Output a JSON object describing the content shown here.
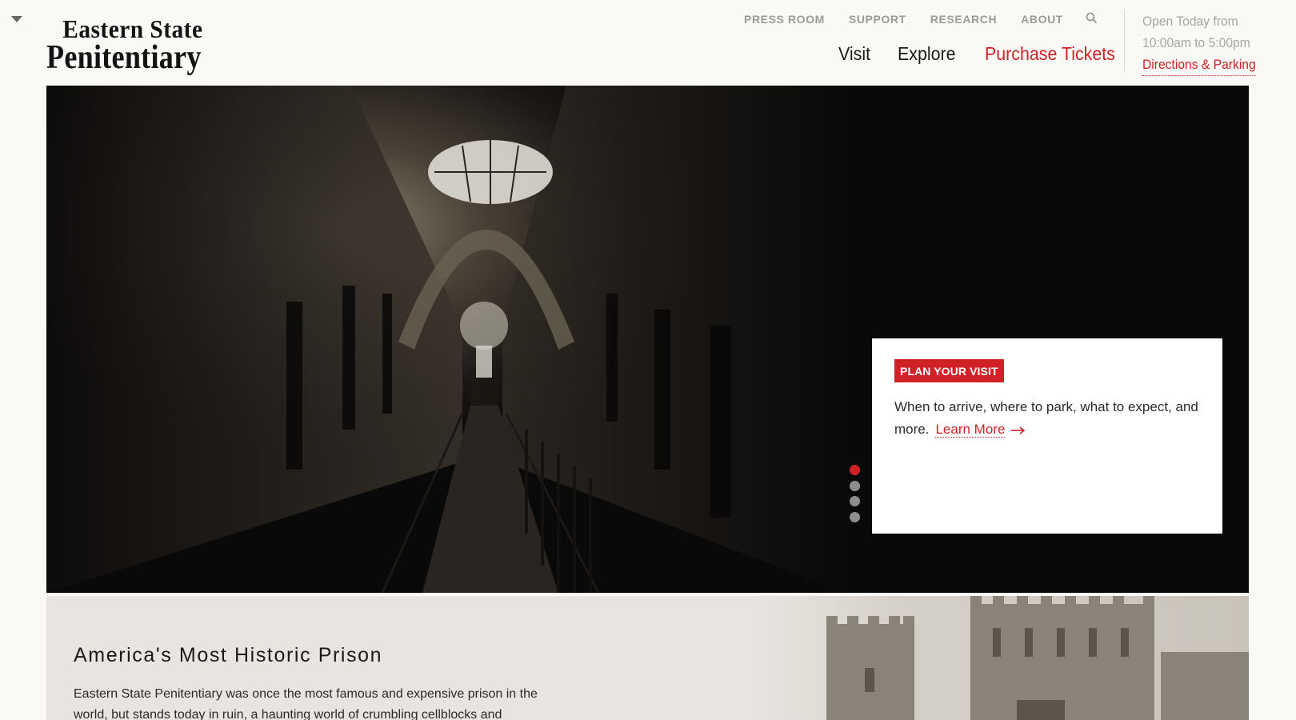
{
  "logo": {
    "line1": "Eastern State",
    "line2": "Penitentiary"
  },
  "utility_nav": [
    {
      "label": "PRESS ROOM"
    },
    {
      "label": "SUPPORT"
    },
    {
      "label": "RESEARCH"
    },
    {
      "label": "ABOUT"
    }
  ],
  "main_nav": {
    "visit": "Visit",
    "explore": "Explore",
    "tickets": "Purchase Tickets"
  },
  "hours": {
    "line1": "Open Today from",
    "line2": "10:00am to 5:00pm",
    "directions": "Directions & Parking"
  },
  "hero": {
    "badge": "PLAN YOUR VISIT",
    "text": "When to arrive, where to park, what to expect, and more.",
    "link": "Learn More",
    "active_slide": 1,
    "slide_count": 4
  },
  "intro": {
    "title": "America's Most Historic Prison",
    "body": "Eastern State Penitentiary was once the most famous and expensive prison in the world, but stands today in ruin, a haunting world of crumbling cellblocks and empty"
  },
  "colors": {
    "brand_red": "#d02127",
    "background": "#fbf9f6",
    "muted": "#9a9a9a"
  }
}
